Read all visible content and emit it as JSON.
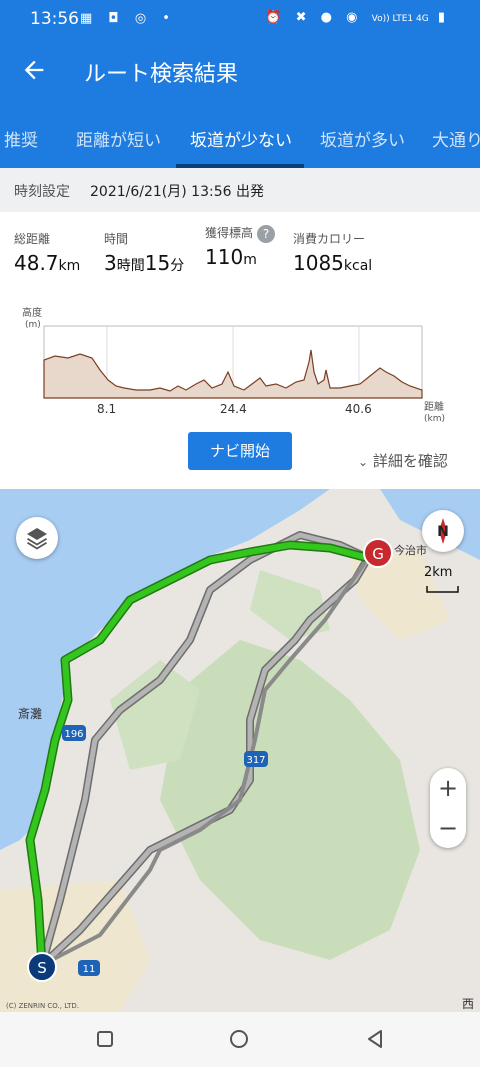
{
  "status_bar": {
    "time": "13:56",
    "network": "Vo)) LTE1 4G"
  },
  "header": {
    "title": "ルート検索結果"
  },
  "tabs": [
    {
      "label": "推奨"
    },
    {
      "label": "距離が短い"
    },
    {
      "label": "坂道が少ない"
    },
    {
      "label": "坂道が多い"
    },
    {
      "label": "大通り"
    }
  ],
  "active_tab": "坂道が少ない",
  "time_setting": {
    "label": "時刻設定",
    "value": "2021/6/21(月) 13:56 出発"
  },
  "stats": {
    "distance": {
      "label": "総距離",
      "value": "48.7",
      "unit": "km"
    },
    "duration": {
      "label": "時間",
      "hours": "3",
      "hours_unit": "時間",
      "minutes": "15",
      "minutes_unit": "分"
    },
    "elevation": {
      "label": "獲得標高",
      "value": "110",
      "unit": "m"
    },
    "calories": {
      "label": "消費カロリー",
      "value": "1085",
      "unit": "kcal"
    }
  },
  "elevation_profile": {
    "y_label": "高度",
    "y_unit": "(m)",
    "x_label": "距離",
    "x_unit": "(km)",
    "x_ticks": [
      "8.1",
      "24.4",
      "40.6"
    ]
  },
  "actions": {
    "start_nav": "ナビ開始",
    "details": "詳細を確認"
  },
  "map": {
    "scale": "2km",
    "compass": "N",
    "start_marker": "S",
    "goal_marker": "G",
    "place_labels": [
      "今治市",
      "斎灘",
      "西"
    ],
    "route_shields": [
      "196",
      "317",
      "11"
    ],
    "copyright": "(C) ZENRIN CO., LTD.",
    "zoom_in": "+",
    "zoom_out": "−",
    "colors": {
      "sea": "#a7cdf2",
      "land": "#e9e6e1",
      "mountain": "#c5dcb6",
      "selected_route": "#35c51f",
      "alt_route": "#9b9b9b",
      "goal": "#c8292f",
      "start": "#0b3a7a"
    }
  },
  "colors": {
    "primary": "#1e7be0",
    "tab_indicator": "#0a3e80"
  }
}
